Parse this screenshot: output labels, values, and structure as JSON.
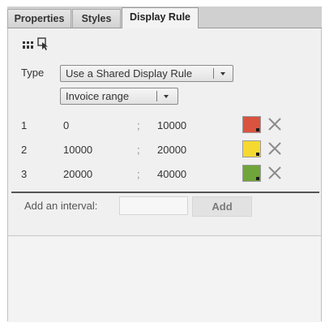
{
  "tabs": [
    {
      "label": "Properties"
    },
    {
      "label": "Styles"
    },
    {
      "label": "Display Rule",
      "active": true
    }
  ],
  "toolbar": {
    "icons": [
      "grid-icon",
      "cursor-select-icon"
    ]
  },
  "type_row": {
    "label": "Type",
    "selected": "Use a Shared Display Rule"
  },
  "rule_select": {
    "selected": "Invoice range"
  },
  "intervals": [
    {
      "index": "1",
      "from": "0",
      "sep": ";",
      "to": "10000",
      "color": "#d9533f"
    },
    {
      "index": "2",
      "from": "10000",
      "sep": ";",
      "to": "20000",
      "color": "#f5d930"
    },
    {
      "index": "3",
      "from": "20000",
      "sep": ";",
      "to": "40000",
      "color": "#6fa53a"
    }
  ],
  "add_interval": {
    "label": "Add an interval:",
    "value": "",
    "button_label": "Add"
  }
}
